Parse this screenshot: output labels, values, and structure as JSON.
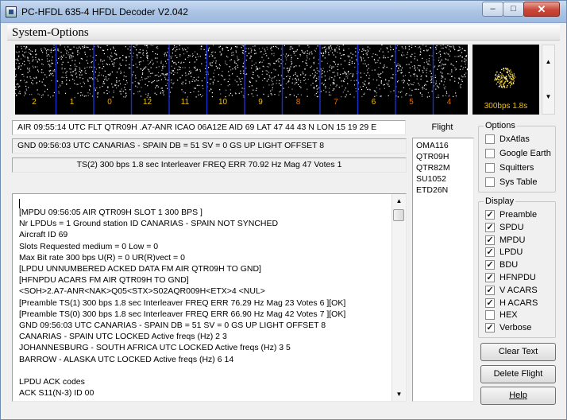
{
  "window": {
    "title": "PC-HFDL 635-4 HFDL Decoder V2.042",
    "min_glyph": "–",
    "max_glyph": "□",
    "close_glyph": "✕"
  },
  "menu": {
    "item": "System-Options"
  },
  "spectrum": {
    "channels": [
      "2",
      "1",
      "0",
      "12",
      "11",
      "10",
      "9",
      "8",
      "7",
      "6",
      "5",
      "4"
    ],
    "channel_colors": [
      "#f0c000",
      "#f0c000",
      "#f0a000",
      "#f0c000",
      "#f0c000",
      "#f0c000",
      "#f0c000",
      "#e07000",
      "#e07000",
      "#f0c000",
      "#e07000",
      "#e07000"
    ],
    "scope_caption": "300bps 1.8s",
    "scroll_up": "▲",
    "scroll_down": "▼"
  },
  "status": {
    "air_line": "AIR 09:55:14  UTC FLT QTR09H .A7-ANR ICAO 06A12E AID 69 LAT 47 44 43  N  LON 15 19 29  E",
    "gnd_line": "GND 09:56:03 UTC CANARIAS - SPAIN   DB = 51  SV = 0  GS UP LIGHT  OFFSET 8",
    "ts_line": "TS(2) 300  bps 1.8 sec Interleaver FREQ ERR 70.92 Hz Mag 47 Votes 1"
  },
  "flight": {
    "header": "Flight",
    "items": [
      "OMA116",
      "QTR09H",
      "QTR82M",
      "SU1052",
      "ETD26N"
    ]
  },
  "log": {
    "lines": [
      "[MPDU 09:56:05 AIR QTR09H SLOT 1 300 BPS ]",
      "Nr LPDUs = 1 Ground station ID CANARIAS - SPAIN  NOT SYNCHED",
      "Aircraft ID 69",
      "Slots Requested medium = 0 Low = 0",
      "Max Bit rate 300 bps U(R) = 0 UR(R)vect = 0",
      "[LPDU UNNUMBERED ACKED DATA FM AIR QTR09H TO GND]",
      "[HFNPDU ACARS FM AIR QTR09H TO GND]",
      "<SOH>2.A7-ANR<NAK>Q05<STX>S02AQR009H<ETX>4 <NUL>",
      "[Preamble TS(1) 300  bps 1.8 sec Interleaver FREQ ERR 76.29 Hz Mag 23 Votes 6 ][OK]",
      "[Preamble TS(0) 300  bps 1.8 sec Interleaver FREQ ERR 66.90 Hz Mag 42 Votes 7 ][OK]",
      " GND 09:56:03 UTC CANARIAS - SPAIN   DB = 51  SV = 0  GS UP LIGHT  OFFSET 8",
      "CANARIAS - SPAIN  UTC LOCKED Active freqs (Hz)        2        3",
      "JOHANNESBURG - SOUTH AFRICA UTC LOCKED Active freqs (Hz)        3        5",
      "BARROW - ALASKA UTC LOCKED Active freqs (Hz)        6       14",
      "",
      "LPDU ACK codes",
      "ACK S11(N-3) ID 00"
    ],
    "scroll_up": "▲",
    "scroll_down": "▼"
  },
  "options": {
    "title": "Options",
    "items": [
      {
        "label": "DxAtlas",
        "checked": false
      },
      {
        "label": "Google Earth",
        "checked": false
      },
      {
        "label": "Squitters",
        "checked": false
      },
      {
        "label": "Sys Table",
        "checked": false
      }
    ]
  },
  "display": {
    "title": "Display",
    "items": [
      {
        "label": "Preamble",
        "checked": true
      },
      {
        "label": "SPDU",
        "checked": true
      },
      {
        "label": "MPDU",
        "checked": true
      },
      {
        "label": "LPDU",
        "checked": true
      },
      {
        "label": "BDU",
        "checked": true
      },
      {
        "label": "HFNPDU",
        "checked": true
      },
      {
        "label": "V ACARS",
        "checked": true
      },
      {
        "label": "H ACARS",
        "checked": true
      },
      {
        "label": "HEX",
        "checked": false
      },
      {
        "label": "Verbose",
        "checked": true
      }
    ]
  },
  "buttons": {
    "clear_text": "Clear Text",
    "delete_flight": "Delete Flight",
    "help": "Help"
  },
  "check_glyph": "✓"
}
